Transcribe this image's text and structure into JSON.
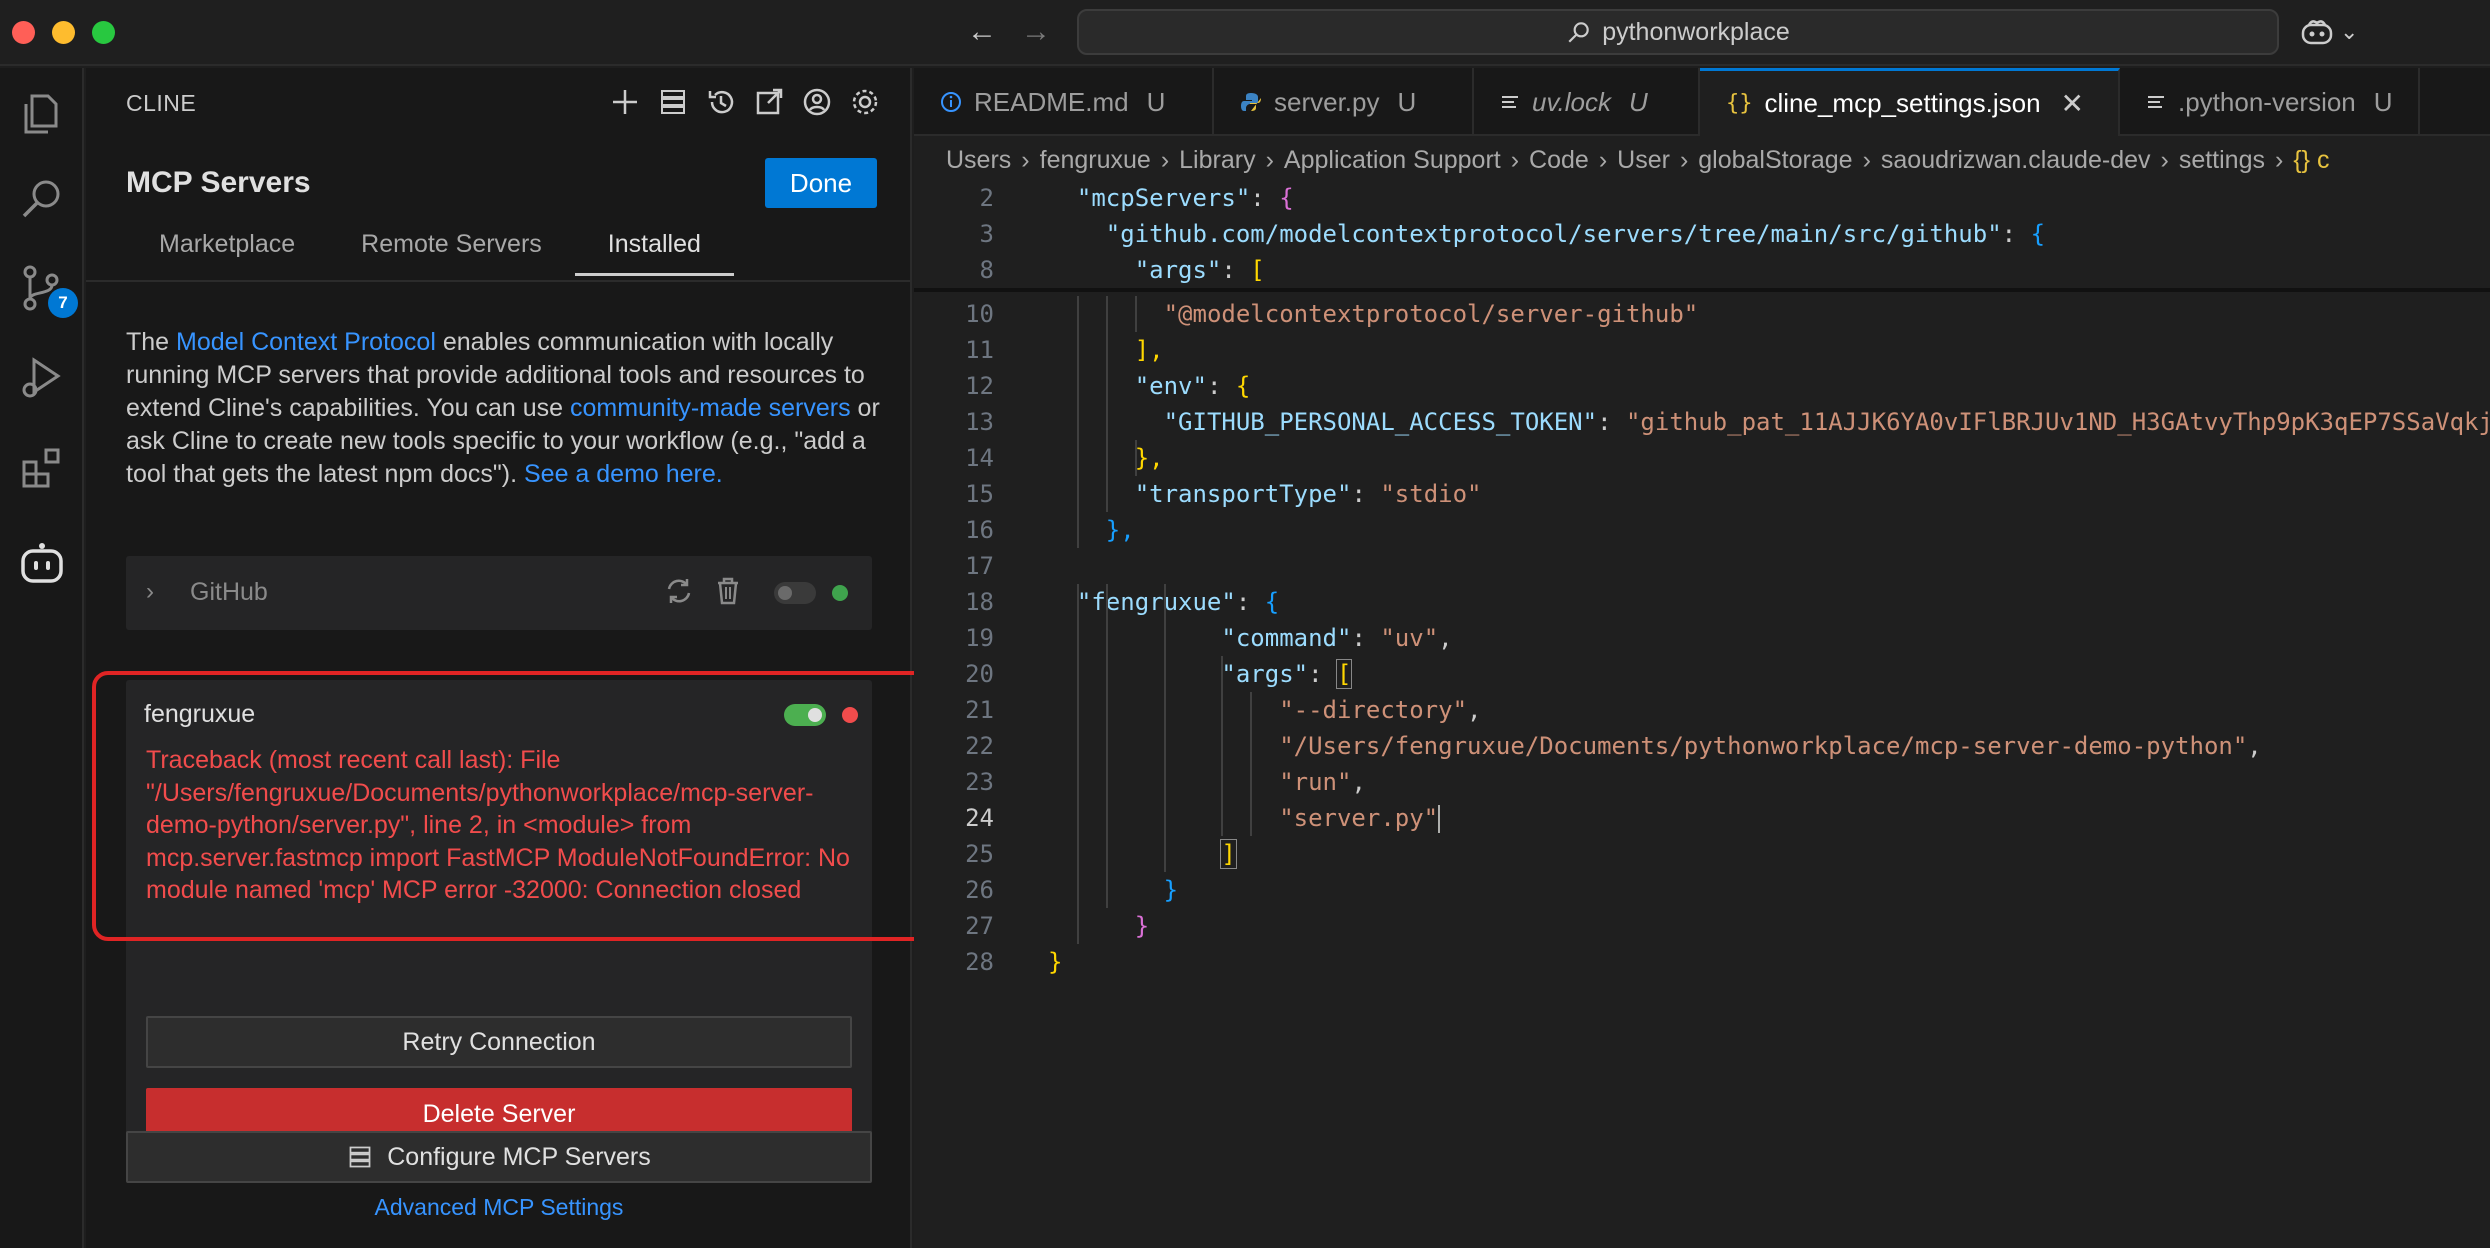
{
  "window": {
    "search_text": "pythonworkplace"
  },
  "activity_bar": {
    "source_control_badge": "7"
  },
  "sidebar": {
    "title": "CLINE",
    "heading": "MCP Servers",
    "done_label": "Done",
    "tabs": [
      "Marketplace",
      "Remote Servers",
      "Installed"
    ],
    "intro": {
      "part1": "The ",
      "link1": "Model Context Protocol",
      "part2": " enables communication with locally running MCP servers that provide additional tools and resources to extend Cline's capabilities. You can use ",
      "link2": "community-made servers",
      "part3": " or ask Cline to create new tools specific to your workflow (e.g., \"add a tool that gets the latest npm docs\"). ",
      "link3": "See a demo here."
    },
    "servers": [
      {
        "name": "GitHub",
        "enabled": false,
        "status_color": "#3fa34d"
      },
      {
        "name": "fengruxue",
        "enabled": true,
        "status_color": "#f14c4c",
        "error": "Traceback (most recent call last): File \"/Users/fengruxue/Documents/pythonworkplace/mcp-server-demo-python/server.py\", line 2, in <module> from mcp.server.fastmcp import FastMCP ModuleNotFoundError: No module named 'mcp' MCP error -32000: Connection closed"
      }
    ],
    "retry_label": "Retry Connection",
    "delete_label": "Delete Server",
    "configure_label": "Configure MCP Servers",
    "advanced_label": "Advanced MCP Settings"
  },
  "editor": {
    "tabs": [
      {
        "label": "README.md",
        "badge": "U",
        "icon": "info-icon"
      },
      {
        "label": "server.py",
        "badge": "U",
        "icon": "python-icon"
      },
      {
        "label": "uv.lock",
        "badge": "U",
        "icon": "lines-icon"
      },
      {
        "label": "cline_mcp_settings.json",
        "badge": "",
        "icon": "json-icon"
      },
      {
        "label": ".python-version",
        "badge": "U",
        "icon": "lines-icon"
      }
    ],
    "breadcrumbs": [
      "Users",
      "fengruxue",
      "Library",
      "Application Support",
      "Code",
      "User",
      "globalStorage",
      "saoudrizwan.claude-dev",
      "settings",
      "{} c"
    ],
    "code_lines": [
      {
        "n": "2",
        "k": "\"mcpServers\"",
        "rest": ": {"
      },
      {
        "n": "3",
        "k": "\"github.com/modelcontextprotocol/servers/tree/main/src/github\"",
        "rest": ": {"
      },
      {
        "n": "8",
        "k": "\"args\"",
        "rest": ": ["
      },
      {
        "n": "10",
        "s": "\"@modelcontextprotocol/server-github\""
      },
      {
        "n": "11",
        "rest": "],"
      },
      {
        "n": "12",
        "k": "\"env\"",
        "rest": ": {"
      },
      {
        "n": "13",
        "k": "\"GITHUB_PERSONAL_ACCESS_TOKEN\"",
        "s": "\"github_pat_11AJJK6YA0vIFlBRJUv1ND_H3GAtvyThp9pK3qEP7SSaVqkj"
      },
      {
        "n": "14",
        "rest": "},"
      },
      {
        "n": "15",
        "k": "\"transportType\"",
        "s": "\"stdio\""
      },
      {
        "n": "16",
        "rest": "},"
      },
      {
        "n": "17"
      },
      {
        "n": "18",
        "k": "\"fengruxue\"",
        "rest": ": {"
      },
      {
        "n": "19",
        "k": "\"command\"",
        "s": "\"uv\""
      },
      {
        "n": "20",
        "k": "\"args\"",
        "rest": ": ["
      },
      {
        "n": "21",
        "s": "\"--directory\""
      },
      {
        "n": "22",
        "s": "\"/Users/fengruxue/Documents/pythonworkplace/mcp-server-demo-python\""
      },
      {
        "n": "23",
        "s": "\"run\""
      },
      {
        "n": "24",
        "s": "\"server.py\""
      },
      {
        "n": "25",
        "rest": "]"
      },
      {
        "n": "26",
        "rest": "}"
      },
      {
        "n": "27",
        "rest": "}"
      },
      {
        "n": "28",
        "rest": "}"
      }
    ],
    "current_line": "24"
  }
}
